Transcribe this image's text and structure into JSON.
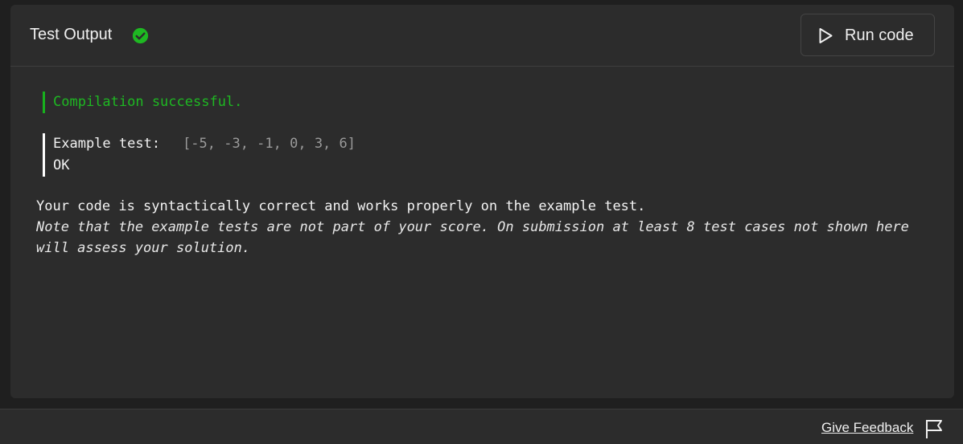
{
  "header": {
    "title": "Test Output",
    "status_icon": "check-circle-icon",
    "run_button_label": "Run code"
  },
  "output": {
    "compilation": "Compilation successful.",
    "example_label": "Example test:",
    "example_input": "[-5, -3, -1, 0, 3, 6]",
    "example_result": "OK",
    "summary": "Your code is syntactically correct and works properly on the example test.",
    "note": "Note that the example tests are not part of your score. On submission at least 8 test cases not shown here will assess your solution."
  },
  "footer": {
    "feedback_label": "Give Feedback",
    "feedback_icon": "flag-icon"
  },
  "colors": {
    "success": "#1eb822",
    "background": "#2c2c2c",
    "page": "#1f1f1f"
  }
}
